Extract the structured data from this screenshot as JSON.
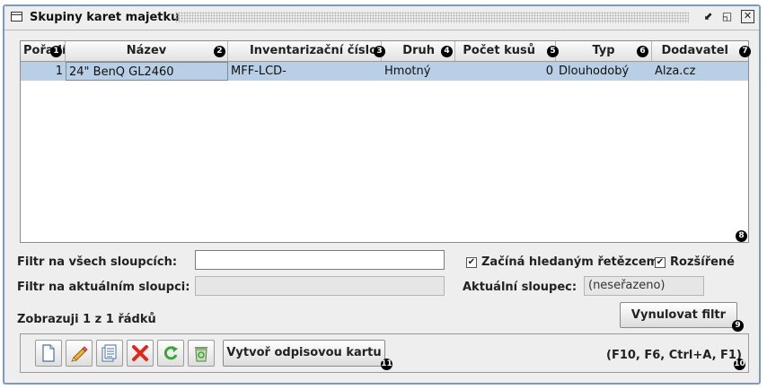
{
  "window": {
    "title": "Skupiny karet majetku",
    "controls": {
      "minimize": "⬋",
      "maximize": "◱",
      "close": "✕"
    }
  },
  "table": {
    "columns": [
      {
        "label": "Pořadí",
        "badge": "1"
      },
      {
        "label": "Název",
        "badge": "2"
      },
      {
        "label": "Inventarizační číslo",
        "badge": "3"
      },
      {
        "label": "Druh",
        "badge": "4"
      },
      {
        "label": "Počet kusů",
        "badge": "5"
      },
      {
        "label": "Typ",
        "badge": "6"
      },
      {
        "label": "Dodavatel",
        "badge": "7"
      }
    ],
    "rows": [
      {
        "poradi": "1",
        "nazev": "24\" BenQ GL2460",
        "inventarizacni_cislo": "MFF-LCD-",
        "druh": "Hmotný",
        "pocet_kusu": "0",
        "typ": "Dlouhodobý",
        "dodavatel": "Alza.cz"
      }
    ],
    "panel_badge": "8"
  },
  "filters": {
    "all_columns_label": "Filtr na všech sloupcích:",
    "all_columns_value": "",
    "current_column_label": "Filtr na aktuálním sloupci:",
    "current_column_value": "",
    "starts_with_label": "Začíná hledaným řetězcem",
    "starts_with_checked": true,
    "extended_label": "Rozšířené",
    "extended_checked": true,
    "current_column_caption": "Aktuální sloupec:",
    "current_column_name": "(neseřazeno)"
  },
  "status": {
    "rows_shown": "Zobrazuji 1 z 1 řádků"
  },
  "buttons": {
    "reset_filter": "Vynulovat filtr",
    "reset_filter_badge": "9",
    "create_writeoff": "Vytvoř odpisovou kartu",
    "create_writeoff_badge": "11"
  },
  "toolbar": {
    "tools": [
      {
        "icon": "new-document-icon"
      },
      {
        "icon": "edit-pencil-icon"
      },
      {
        "icon": "list-document-icon"
      },
      {
        "icon": "delete-x-icon"
      },
      {
        "icon": "refresh-icon"
      },
      {
        "icon": "recycle-bin-icon"
      }
    ],
    "shortcuts": "(F10, F6, Ctrl+A, F1)",
    "shortcuts_badge": "10"
  },
  "colors": {
    "selection": "#b8cfe5",
    "frame_border": "#7b9bc4",
    "delete_red": "#e0281c",
    "refresh_green": "#3aa635"
  }
}
